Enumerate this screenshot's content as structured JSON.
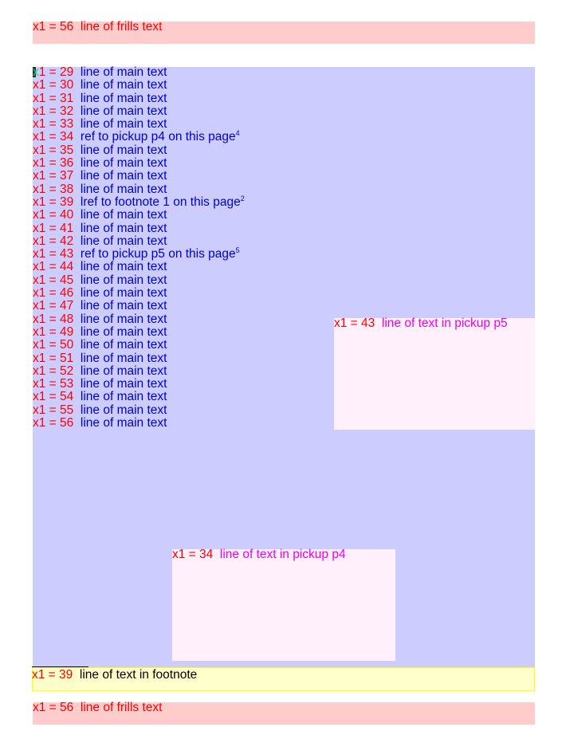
{
  "frills_top": {
    "label": "x1 = 56",
    "text": "line of frills text"
  },
  "main": {
    "lines": [
      {
        "label": "x1 = 29",
        "text": "line of main text",
        "sup": ""
      },
      {
        "label": "x1 = 30",
        "text": "line of main text",
        "sup": ""
      },
      {
        "label": "x1 = 31",
        "text": "line of main text",
        "sup": ""
      },
      {
        "label": "x1 = 32",
        "text": "line of main text",
        "sup": ""
      },
      {
        "label": "x1 = 33",
        "text": "line of main text",
        "sup": ""
      },
      {
        "label": "x1 = 34",
        "text": "ref to pickup p4 on this page",
        "sup": "4"
      },
      {
        "label": "x1 = 35",
        "text": "line of main text",
        "sup": ""
      },
      {
        "label": "x1 = 36",
        "text": "line of main text",
        "sup": ""
      },
      {
        "label": "x1 = 37",
        "text": "line of main text",
        "sup": ""
      },
      {
        "label": "x1 = 38",
        "text": "line of main text",
        "sup": ""
      },
      {
        "label": "x1 = 39",
        "text": "lref to footnote 1 on this page",
        "sup": "2"
      },
      {
        "label": "x1 = 40",
        "text": "line of main text",
        "sup": ""
      },
      {
        "label": "x1 = 41",
        "text": "line of main text",
        "sup": ""
      },
      {
        "label": "x1 = 42",
        "text": "line of main text",
        "sup": ""
      },
      {
        "label": "x1 = 43",
        "text": "ref to pickup p5 on this page",
        "sup": "5"
      },
      {
        "label": "x1 = 44",
        "text": "line of main text",
        "sup": ""
      },
      {
        "label": "x1 = 45",
        "text": "line of main text",
        "sup": ""
      },
      {
        "label": "x1 = 46",
        "text": "line of main text",
        "sup": ""
      },
      {
        "label": "x1 = 47",
        "text": "line of main text",
        "sup": ""
      },
      {
        "label": "x1 = 48",
        "text": "line of main text",
        "sup": ""
      },
      {
        "label": "x1 = 49",
        "text": "line of main text",
        "sup": ""
      },
      {
        "label": "x1 = 50",
        "text": "line of main text",
        "sup": ""
      },
      {
        "label": "x1 = 51",
        "text": "line of main text",
        "sup": ""
      },
      {
        "label": "x1 = 52",
        "text": "line of main text",
        "sup": ""
      },
      {
        "label": "x1 = 53",
        "text": "line of main text",
        "sup": ""
      },
      {
        "label": "x1 = 54",
        "text": "line of main text",
        "sup": ""
      },
      {
        "label": "x1 = 55",
        "text": "line of main text",
        "sup": ""
      },
      {
        "label": "x1 = 56",
        "text": "line of main text",
        "sup": ""
      }
    ]
  },
  "pickup_p5": {
    "label": "x1 = 43",
    "text": "line of text in pickup p5"
  },
  "pickup_p4": {
    "label": "x1 = 34",
    "text": "line of text in pickup p4"
  },
  "footnote": {
    "label": "x1 = 39",
    "text": "line of text in footnote"
  },
  "frills_bottom": {
    "label": "x1 = 56",
    "text": "line of frills text"
  }
}
